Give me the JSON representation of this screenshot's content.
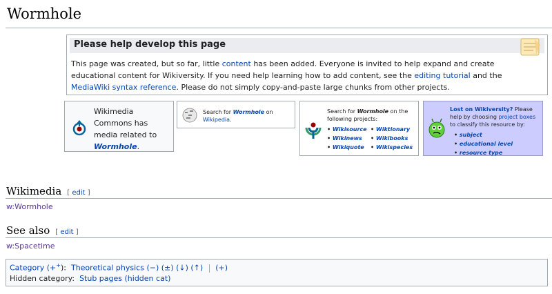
{
  "page": {
    "title": "Wormhole"
  },
  "notice": {
    "heading": "Please help develop this page",
    "p1": "This page was created, but so far, little ",
    "link_content": "content",
    "p2": " has been added. Everyone is invited to help expand and create educational content for Wikiversity. If you need help learning how to add content, see the ",
    "link_tutorial": "editing tutorial",
    "p3": " and the ",
    "link_syntax": "MediaWiki syntax reference",
    "p4": ". Please do not simply copy-and-paste large chunks from other projects.",
    "icon": "notepad-icon"
  },
  "commons": {
    "text": "Wikimedia Commons has media related to ",
    "link": "Wormhole",
    "end": ".",
    "icon": "wikimedia-commons-icon"
  },
  "wikipedia_box": {
    "prefix": "Search for ",
    "term": "Wormhole",
    "middle": " on ",
    "link": "Wikipedia",
    "end": ".",
    "icon": "wikipedia-globe-icon"
  },
  "sister_projects": {
    "prefix": "Search for ",
    "term": "Wormhole",
    "suffix": " on the following projects:",
    "icon": "wikimedia-logo-icon",
    "projects": [
      "Wikisource",
      "Wiktionary",
      "Wikinews",
      "Wikibooks",
      "Wikiquote",
      "Wikispecies"
    ]
  },
  "lost": {
    "heading": "Lost on Wikiversity?",
    "text1": " Please help by choosing ",
    "link": "project boxes",
    "text2": " to classify this resource by:",
    "items": [
      "subject",
      "educational level",
      "resource type"
    ],
    "icon": "confused-alien-icon"
  },
  "sections": [
    {
      "heading": "Wikimedia",
      "edit": "edit",
      "link": "w:Wormhole"
    },
    {
      "heading": "See also",
      "edit": "edit",
      "link": "w:Spacetime"
    }
  ],
  "categories": {
    "label": "Category",
    "add": "(+",
    "add_sup": "+",
    "close": "):",
    "category": "Theoretical physics",
    "controls": [
      "(−)",
      "(±)",
      "(↓)",
      "(↑)"
    ],
    "plus": "(+)",
    "hidden_label": "Hidden category:",
    "hidden": "Stub pages (hidden cat)"
  }
}
